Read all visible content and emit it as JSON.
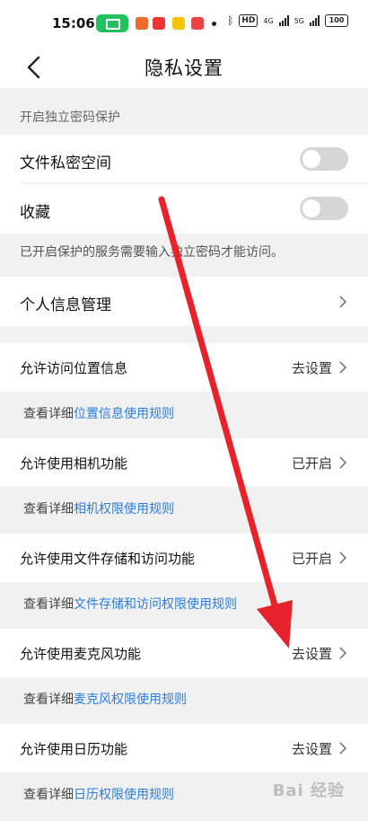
{
  "status_bar": {
    "time": "15:06",
    "badge_hd": "HD",
    "network": "4G",
    "network2": "5G",
    "battery": "100"
  },
  "header": {
    "title": "隐私设置"
  },
  "password_section": {
    "label": "开启独立密码保护",
    "items": [
      {
        "label": "文件私密空间",
        "toggle": false
      },
      {
        "label": "收藏",
        "toggle": false
      }
    ],
    "note": "已开启保护的服务需要输入独立密码才能访问。"
  },
  "personal_info": {
    "label": "个人信息管理"
  },
  "permissions": [
    {
      "label": "允许访问位置信息",
      "value": "去设置",
      "detail_prefix": "查看详细",
      "detail_link": "位置信息使用规则"
    },
    {
      "label": "允许使用相机功能",
      "value": "已开启",
      "detail_prefix": "查看详细",
      "detail_link": "相机权限使用规则"
    },
    {
      "label": "允许使用文件存储和访问功能",
      "value": "已开启",
      "detail_prefix": "查看详细",
      "detail_link": "文件存储和访问权限使用规则"
    },
    {
      "label": "允许使用麦克风功能",
      "value": "去设置",
      "detail_prefix": "查看详细",
      "detail_link": "麦克风权限使用规则"
    },
    {
      "label": "允许使用日历功能",
      "value": "去设置",
      "detail_prefix": "查看详细",
      "detail_link": "日历权限使用规则"
    }
  ],
  "annotation": {
    "arrow_color": "#e8222a"
  },
  "watermark": "Bai 经验"
}
